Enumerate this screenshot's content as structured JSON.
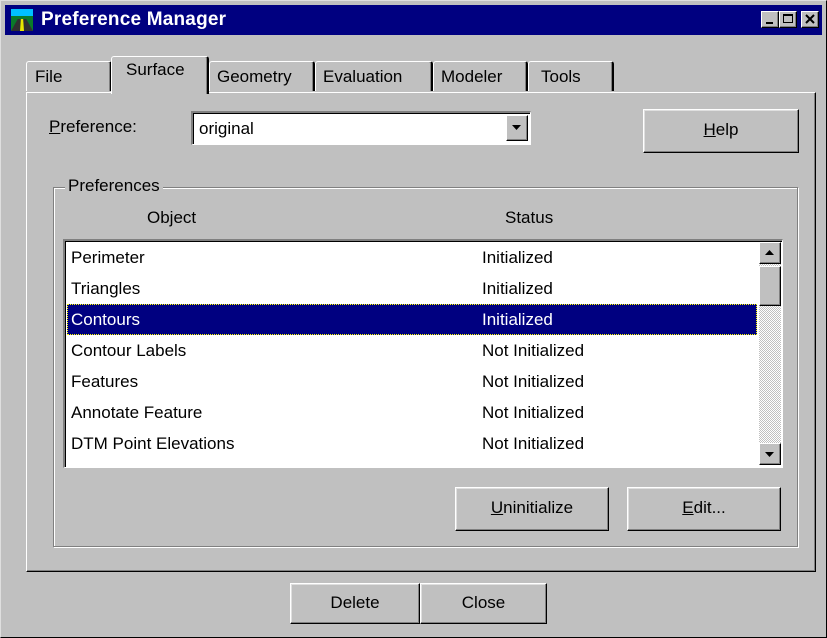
{
  "window": {
    "title": "Preference Manager",
    "icon": "road-map-icon",
    "controls": [
      "minimize-icon",
      "maximize-icon",
      "close-icon"
    ]
  },
  "tabs": [
    {
      "label": "File",
      "active": false
    },
    {
      "label": "Surface",
      "active": true
    },
    {
      "label": "Geometry",
      "active": false
    },
    {
      "label": "Evaluation",
      "active": false
    },
    {
      "label": "Modeler",
      "active": false
    },
    {
      "label": "Tools",
      "active": false
    }
  ],
  "preference": {
    "label_accel": "P",
    "label_rest": "reference:",
    "value": "original"
  },
  "help_button": {
    "accel": "H",
    "rest": "elp"
  },
  "preferences_group": {
    "title": "Preferences",
    "columns": [
      "Object",
      "Status"
    ],
    "rows": [
      {
        "object": "Perimeter",
        "status": "Initialized",
        "selected": false
      },
      {
        "object": "Triangles",
        "status": "Initialized",
        "selected": false
      },
      {
        "object": "Contours",
        "status": "Initialized",
        "selected": true
      },
      {
        "object": "Contour Labels",
        "status": "Not Initialized",
        "selected": false
      },
      {
        "object": "Features",
        "status": "Not Initialized",
        "selected": false
      },
      {
        "object": "Annotate Feature",
        "status": "Not Initialized",
        "selected": false
      },
      {
        "object": "DTM Point Elevations",
        "status": "Not Initialized",
        "selected": false
      }
    ]
  },
  "uninitialize_button": {
    "accel": "U",
    "rest": "ninitialize"
  },
  "edit_button": {
    "accel": "E",
    "rest": "dit..."
  },
  "delete_button": "Delete",
  "close_button": "Close",
  "colors": {
    "titlebar": "#000080",
    "face": "#c0c0c0",
    "selection": "#000080"
  }
}
